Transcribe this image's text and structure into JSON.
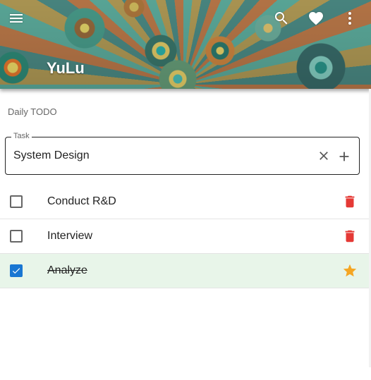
{
  "app": {
    "title": "YuLu",
    "subtitle": "Daily TODO"
  },
  "header_icons": {
    "menu": "menu-icon",
    "search": "search-icon",
    "favorite": "heart-icon",
    "more": "more-vert-icon"
  },
  "task_field": {
    "legend": "Task",
    "value": "System Design",
    "clear_icon": "close-icon",
    "add_icon": "plus-icon"
  },
  "todos": [
    {
      "label": "Conduct R&D",
      "checked": false,
      "action_icon": "trash-icon"
    },
    {
      "label": "Interview",
      "checked": false,
      "action_icon": "trash-icon"
    },
    {
      "label": "Analyze",
      "checked": true,
      "action_icon": "star-icon"
    }
  ],
  "colors": {
    "checkbox_checked": "#1976d2",
    "done_row_bg": "#e8f5e9",
    "trash": "#e53935",
    "star": "#f5a623"
  }
}
